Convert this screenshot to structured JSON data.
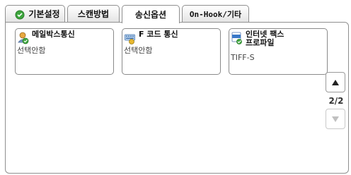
{
  "tabs": [
    {
      "label": "기본설정"
    },
    {
      "label": "스캔방법"
    },
    {
      "label": "송신옵션"
    },
    {
      "label": "On-Hook/기타"
    }
  ],
  "function_buttons": [
    {
      "title": "메일박스통신",
      "value": "선택안함",
      "icon": "mailbox-person-icon"
    },
    {
      "title": "F 코드 통신",
      "value": "선택안함",
      "icon": "f-code-keypad-icon"
    },
    {
      "title": "인터넷 팩스\n프로파일",
      "value": "TIFF-S",
      "icon": "internet-fax-icon"
    }
  ],
  "pagination": {
    "page": "2/2",
    "up_icon": "triangle-up-icon",
    "down_icon": "triangle-down-icon"
  },
  "colors": {
    "border": "#8f8f8f",
    "icon_green": "#3da63d",
    "icon_blue": "#3a78c8",
    "disabled": "#c0c0c0"
  }
}
